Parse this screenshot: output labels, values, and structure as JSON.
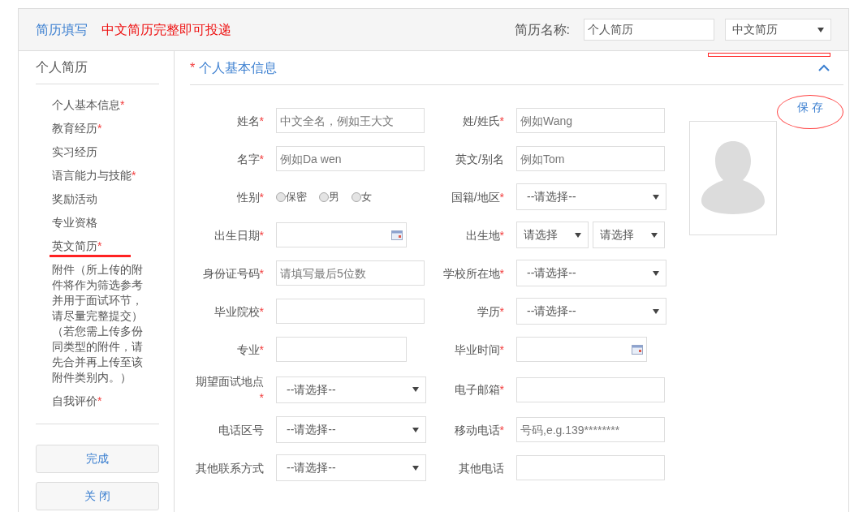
{
  "header": {
    "title": "简历填写",
    "notice": "中文简历完整即可投递",
    "name_label": "简历名称:",
    "name_value": "个人简历",
    "language_select": "中文简历",
    "language_marked": true
  },
  "sidebar": {
    "title": "个人简历",
    "items": [
      {
        "label": "个人基本信息",
        "asterisk": "*",
        "marked": false
      },
      {
        "label": "教育经历",
        "asterisk": "*",
        "marked": false
      },
      {
        "label": "实习经历",
        "marked": false
      },
      {
        "label": "语言能力与技能",
        "asterisk": "*",
        "marked": false
      },
      {
        "label": "奖励活动",
        "marked": false
      },
      {
        "label": "专业资格",
        "marked": false
      },
      {
        "label": "英文简历",
        "asterisk": "*",
        "marked": true
      },
      {
        "label": "附件（所上传的附件将作为筛选参考并用于面试环节，请尽量完整提交）（若您需上传多份同类型的附件，请先合并再上传至该附件类别内。）",
        "marked": false
      },
      {
        "label": "自我评价",
        "asterisk": "*",
        "marked": false
      }
    ],
    "buttons": [
      "完成",
      "关 闭"
    ]
  },
  "section": {
    "asterisk": "*",
    "title": "个人基本信息",
    "expanded": true,
    "save": "保 存",
    "save_circled": true
  },
  "form": {
    "rows": [
      {
        "left": {
          "label": "姓名",
          "asterisk": "*",
          "field": {
            "kind": "text",
            "placeholder": "中文全名，例如王大文"
          }
        },
        "right": {
          "label": "姓/姓氏",
          "asterisk": "*",
          "field": {
            "kind": "text",
            "placeholder": "例如Wang"
          }
        }
      },
      {
        "left": {
          "label": "名字",
          "asterisk": "*",
          "field": {
            "kind": "text",
            "placeholder": "例如Da wen"
          }
        },
        "right": {
          "label": "英文/别名",
          "field": {
            "kind": "text",
            "placeholder": "例如Tom"
          }
        }
      },
      {
        "left": {
          "label": "性别",
          "asterisk": "*",
          "field": {
            "kind": "radio",
            "options": [
              {
                "label": "保密",
                "selected": false
              },
              {
                "label": "男",
                "selected": false
              },
              {
                "label": "女",
                "selected": false
              }
            ]
          }
        },
        "right": {
          "label": "国籍/地区",
          "asterisk": "*",
          "field": {
            "kind": "select",
            "value": "--请选择--"
          }
        }
      },
      {
        "left": {
          "label": "出生日期",
          "asterisk": "*",
          "field": {
            "kind": "date"
          }
        },
        "right": {
          "label": "出生地",
          "asterisk": "*",
          "field": {
            "kind": "select_pair",
            "values": [
              "请选择",
              "请选择"
            ]
          }
        }
      },
      {
        "left": {
          "label": "身份证号码",
          "asterisk": "*",
          "field": {
            "kind": "text",
            "placeholder": "请填写最后5位数"
          }
        },
        "right": {
          "label": "学校所在地",
          "asterisk": "*",
          "field": {
            "kind": "select",
            "value": "--请选择--"
          }
        }
      },
      {
        "left": {
          "label": "毕业院校",
          "asterisk": "*",
          "field": {
            "kind": "text"
          }
        },
        "right": {
          "label": "学历",
          "asterisk": "*",
          "field": {
            "kind": "select",
            "value": "--请选择--"
          }
        }
      },
      {
        "left": {
          "label": "专业",
          "asterisk": "*",
          "field": {
            "kind": "date_plain"
          }
        },
        "right": {
          "label": "毕业时间",
          "asterisk": "*",
          "field": {
            "kind": "date"
          }
        }
      },
      {
        "left": {
          "label": "期望面试地点",
          "asterisk": "*",
          "field": {
            "kind": "select",
            "value": "--请选择--"
          }
        },
        "right": {
          "label": "电子邮箱",
          "asterisk": "*",
          "field": {
            "kind": "text"
          }
        }
      },
      {
        "left": {
          "label": "电话区号",
          "field": {
            "kind": "select",
            "value": "--请选择--"
          }
        },
        "right": {
          "label": "移动电话",
          "asterisk": "*",
          "field": {
            "kind": "text",
            "placeholder": "号码,e.g.139********"
          }
        }
      },
      {
        "left": {
          "label": "其他联系方式",
          "field": {
            "kind": "select",
            "value": "--请选择--"
          }
        },
        "right": {
          "label": "其他电话",
          "field": {
            "kind": "text"
          }
        }
      }
    ]
  }
}
